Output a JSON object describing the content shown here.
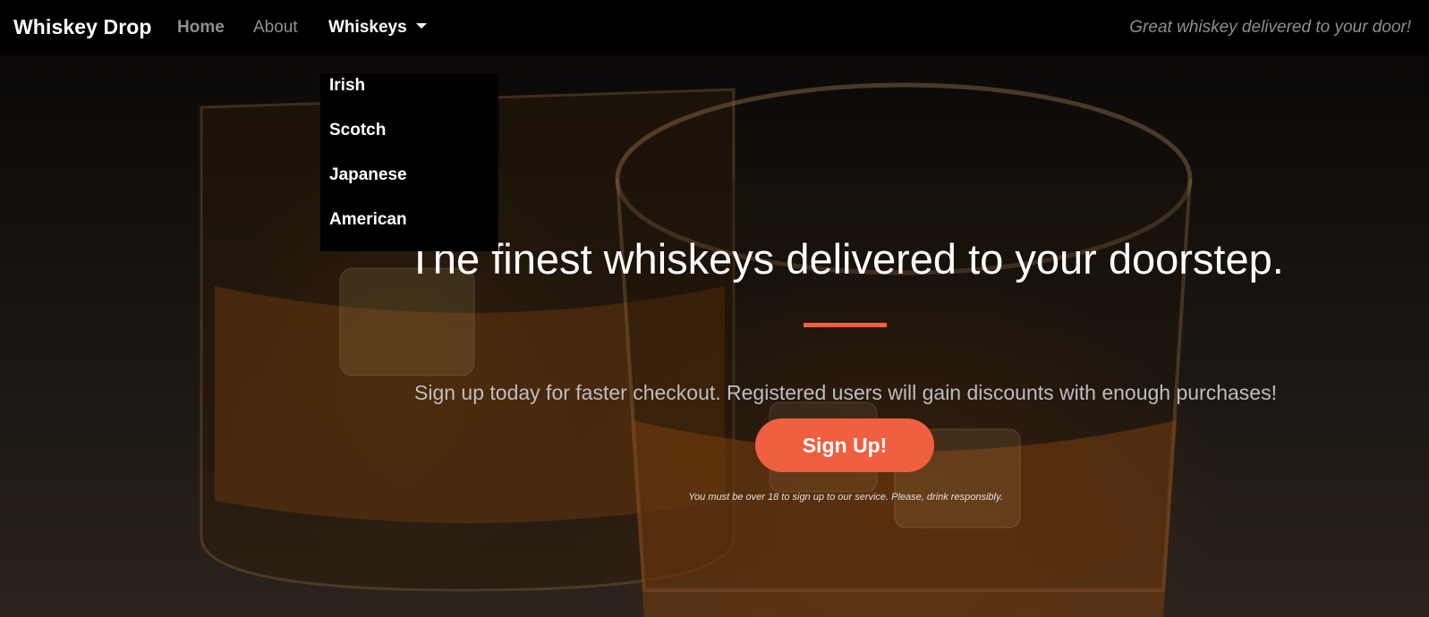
{
  "navbar": {
    "brand": "Whiskey Drop",
    "links": {
      "home": "Home",
      "about": "About",
      "whiskeys": "Whiskeys"
    },
    "tagline": "Great whiskey delivered to your door!"
  },
  "dropdown": {
    "items": [
      "Irish",
      "Scotch",
      "Japanese",
      "American"
    ]
  },
  "hero": {
    "title": "The finest whiskeys delivered to your doorstep.",
    "subtitle": "Sign up today for faster checkout. Registered users will gain discounts with enough purchases!",
    "cta_label": "Sign Up!",
    "disclaimer": "You must be over 18 to sign up to our service. Please, drink responsibly."
  },
  "colors": {
    "accent": "#f05f40",
    "navbar_bg": "#000000",
    "muted_link": "#8f8f8f"
  }
}
